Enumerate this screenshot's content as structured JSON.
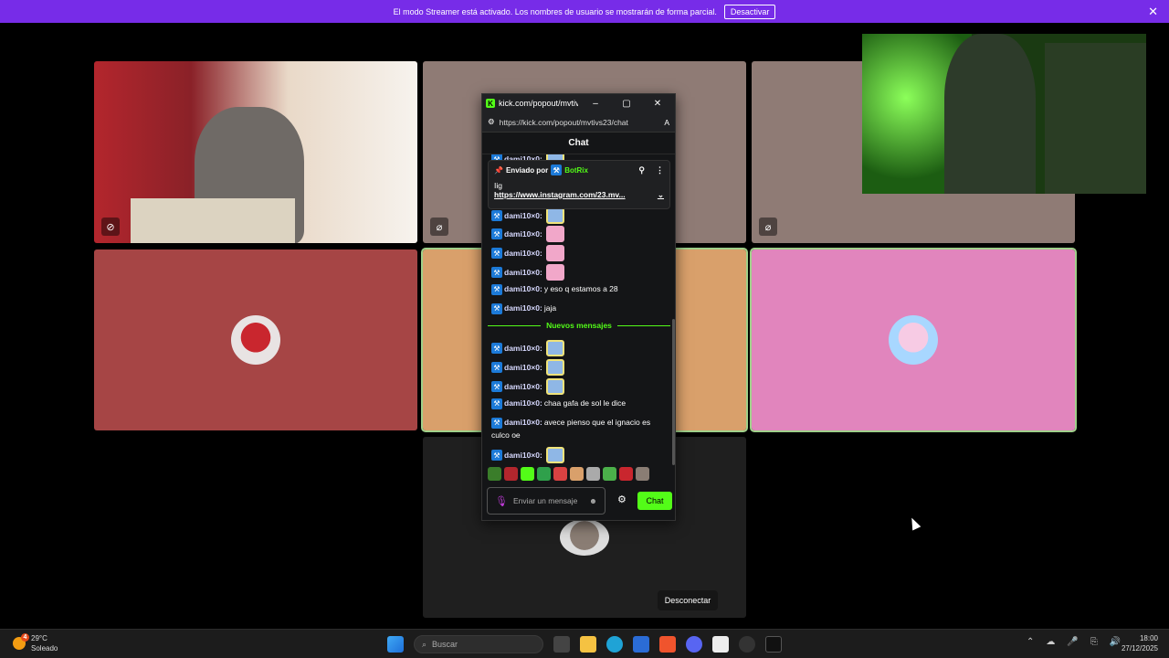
{
  "banner": {
    "text": "El modo Streamer está activado. Los nombres de usuario se mostrarán de forma parcial.",
    "button": "Desactivar"
  },
  "call": {
    "disconnect_label": "Desconectar"
  },
  "popup": {
    "window_title": "kick.com/popout/mvtiv...",
    "url": "https://kick.com/popout/mvtivs23/chat",
    "chat_title": "Chat",
    "pinned": {
      "sent_by": "Enviado por",
      "author": "BotRix",
      "text": "Iig",
      "link": "https://www.instagram.com/23.mv..."
    },
    "new_messages_label": "Nuevos mensajes",
    "messages": [
      {
        "user": "dami10×0:",
        "text": ""
      },
      {
        "user": "dami10×0:",
        "text": ""
      },
      {
        "user": "dami10×0:",
        "text": ""
      },
      {
        "user": "dami10×0:",
        "text": ""
      },
      {
        "user": "dami10×0:",
        "text": "y eso q estamos a 28"
      },
      {
        "user": "dami10×0:",
        "text": "jaja"
      },
      {
        "user": "dami10×0:",
        "text": ""
      },
      {
        "user": "dami10×0:",
        "text": ""
      },
      {
        "user": "dami10×0:",
        "text": ""
      },
      {
        "user": "dami10×0:",
        "text": "chaa gafa de sol le dice"
      },
      {
        "user": "dami10×0:",
        "text": "avece pienso que el ignacio es"
      },
      {
        "user": "",
        "text": "culco oe"
      },
      {
        "user": "dami10×0:",
        "text": ""
      }
    ],
    "composer_placeholder": "Enviar un mensaje",
    "send_label": "Chat"
  },
  "taskbar": {
    "temperature": "29°C",
    "weather_desc": "Soleado",
    "weather_badge": "4",
    "search_placeholder": "Buscar",
    "time": "18:00",
    "date": "27/12/2025"
  },
  "colors": {
    "banner": "#772ce8",
    "kick_green": "#53fc18",
    "tile_red": "#a64545",
    "tile_orange": "#d9a06b",
    "tile_pink": "#e185bd",
    "tile_taupe": "#8f7b75"
  }
}
